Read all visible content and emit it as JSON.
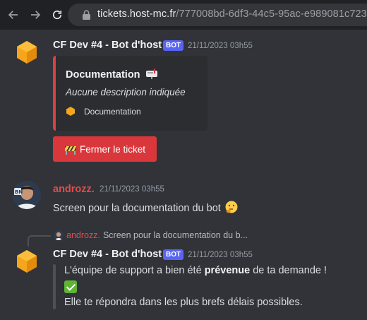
{
  "browser": {
    "url_host": "tickets.host-mc.fr",
    "url_path": "/777008bd-6df3-44c5-95ac-e989081c7239"
  },
  "messages": [
    {
      "author": "CF Dev #4 - Bot d'host",
      "tag": "BOT",
      "timestamp": "21/11/2023 03h55",
      "embed": {
        "title": "Documentation",
        "title_emoji": "mailbox-icon",
        "description": "Aucune description indiquée",
        "field": "Documentation",
        "color": "#e03e3e"
      },
      "button": {
        "label": "Fermer le ticket",
        "emoji": "construction-icon",
        "color": "#da373c"
      }
    },
    {
      "author": "androzz.",
      "author_color": "#e24c4c",
      "timestamp": "21/11/2023 03h55",
      "text": "Screen pour la documentation du bot",
      "emoji": "thinking-face-icon"
    },
    {
      "reply": {
        "author": "androzz.",
        "preview": "Screen pour la documentation du b..."
      },
      "author": "CF Dev #4 - Bot d'host",
      "tag": "BOT",
      "timestamp": "21/11/2023 03h55",
      "lines": {
        "line1_prefix": "L'équipe de support a bien été ",
        "line1_bold": "prévenue",
        "line1_suffix": " de ta demande !",
        "line3": "Elle te répondra dans les plus brefs délais possibles."
      }
    }
  ]
}
